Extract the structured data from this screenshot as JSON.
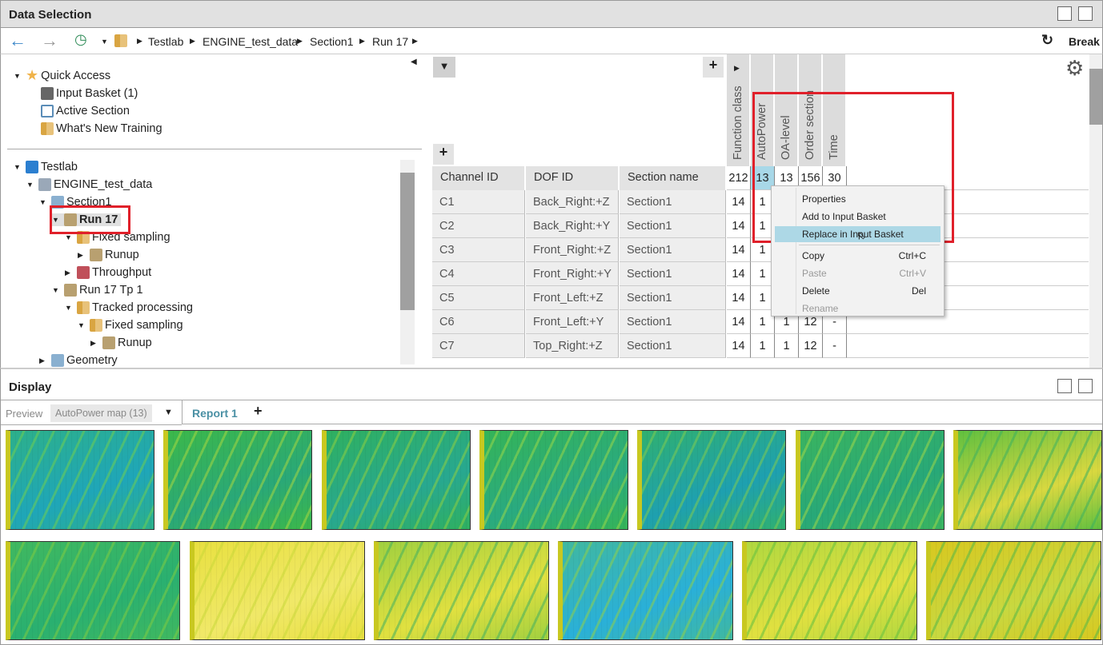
{
  "title": "Data Selection",
  "nav": {
    "breadcrumb": [
      "Testlab",
      "ENGINE_test_data",
      "Section1",
      "Run 17"
    ],
    "break_label": "Break"
  },
  "quick_access": {
    "label": "Quick Access",
    "items": [
      "Input Basket (1)",
      "Active Section",
      "What's New Training"
    ]
  },
  "tree": [
    {
      "label": "Testlab",
      "level": 0
    },
    {
      "label": "ENGINE_test_data",
      "level": 1
    },
    {
      "label": "Section1",
      "level": 2
    },
    {
      "label": "Run 17",
      "level": 3,
      "selected": true
    },
    {
      "label": "Fixed sampling",
      "level": 4
    },
    {
      "label": "Runup",
      "level": 5
    },
    {
      "label": "Throughput",
      "level": 4
    },
    {
      "label": "Run 17 Tp 1",
      "level": 3
    },
    {
      "label": "Tracked processing",
      "level": 4
    },
    {
      "label": "Fixed sampling",
      "level": 5
    },
    {
      "label": "Runup",
      "level": 6
    },
    {
      "label": "Geometry",
      "level": 2
    }
  ],
  "table": {
    "columns": [
      "Channel ID",
      "DOF ID",
      "Section name"
    ],
    "count_columns": [
      "Function class",
      "AutoPower",
      "OA-level",
      "Order section",
      "Time"
    ],
    "totals": [
      "212",
      "13",
      "13",
      "156",
      "30"
    ],
    "rows": [
      {
        "ch": "C1",
        "dof": "Back_Right:+Z",
        "sec": "Section1",
        "vals": [
          "14",
          "1",
          "",
          "",
          ""
        ]
      },
      {
        "ch": "C2",
        "dof": "Back_Right:+Y",
        "sec": "Section1",
        "vals": [
          "14",
          "1",
          "",
          "",
          ""
        ]
      },
      {
        "ch": "C3",
        "dof": "Front_Right:+Z",
        "sec": "Section1",
        "vals": [
          "14",
          "1",
          "",
          "",
          ""
        ]
      },
      {
        "ch": "C4",
        "dof": "Front_Right:+Y",
        "sec": "Section1",
        "vals": [
          "14",
          "1",
          "",
          "",
          ""
        ]
      },
      {
        "ch": "C5",
        "dof": "Front_Left:+Z",
        "sec": "Section1",
        "vals": [
          "14",
          "1",
          "",
          "",
          ""
        ]
      },
      {
        "ch": "C6",
        "dof": "Front_Left:+Y",
        "sec": "Section1",
        "vals": [
          "14",
          "1",
          "1",
          "12",
          "-"
        ]
      },
      {
        "ch": "C7",
        "dof": "Top_Right:+Z",
        "sec": "Section1",
        "vals": [
          "14",
          "1",
          "1",
          "12",
          "-"
        ]
      }
    ]
  },
  "context_menu": [
    {
      "label": "Properties",
      "shortcut": "",
      "enabled": true
    },
    {
      "label": "Add to Input Basket",
      "shortcut": "",
      "enabled": true
    },
    {
      "label": "Replace in Input Basket",
      "shortcut": "",
      "enabled": true,
      "highlighted": true
    },
    {
      "label": "Copy",
      "shortcut": "Ctrl+C",
      "enabled": true
    },
    {
      "label": "Paste",
      "shortcut": "Ctrl+V",
      "enabled": false
    },
    {
      "label": "Delete",
      "shortcut": "Del",
      "enabled": true
    },
    {
      "label": "Rename",
      "shortcut": "",
      "enabled": false
    }
  ],
  "display": {
    "title": "Display",
    "preview_label": "Preview",
    "preview_value": "AutoPower map (13)",
    "tab": "Report 1"
  },
  "colors": {
    "highlight_box": "#e0202a",
    "menu_highlight": "#add8e6",
    "tab_text": "#4a90a4"
  }
}
